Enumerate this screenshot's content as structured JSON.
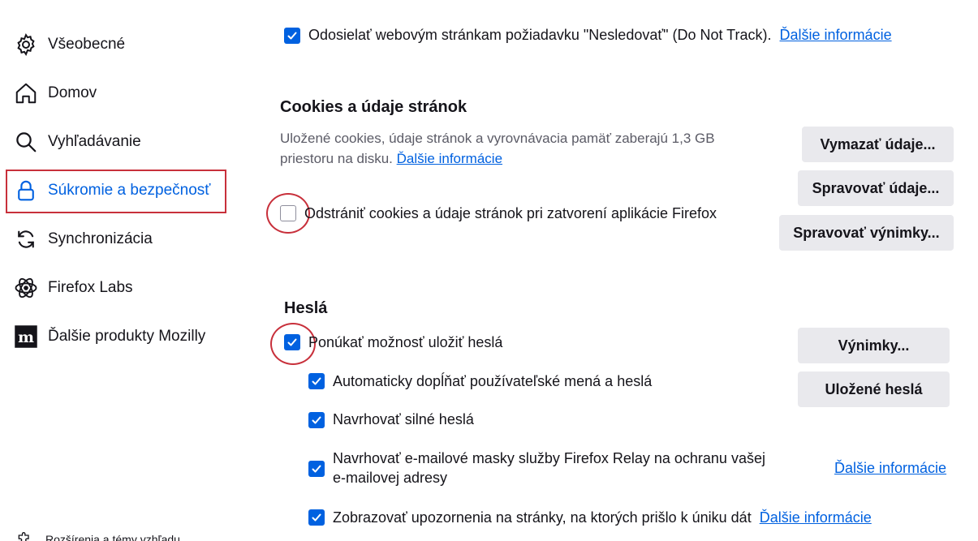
{
  "sidebar": {
    "items": [
      {
        "label": "Všeobecné",
        "icon": "gear-icon"
      },
      {
        "label": "Domov",
        "icon": "home-icon"
      },
      {
        "label": "Vyhľadávanie",
        "icon": "search-icon"
      },
      {
        "label": "Súkromie a bezpečnosť",
        "icon": "lock-icon",
        "active": true
      },
      {
        "label": "Synchronizácia",
        "icon": "sync-icon"
      },
      {
        "label": "Firefox Labs",
        "icon": "labs-icon"
      },
      {
        "label": "Ďalšie produkty Mozilly",
        "icon": "mozilla-icon"
      }
    ],
    "footer_label": "Rozšírenia a témy vzhľadu"
  },
  "dnt": {
    "label": "Odosielať webovým stránkam požiadavku \"Nesledovať\" (Do Not Track).",
    "link": "Ďalšie informácie",
    "checked": true
  },
  "cookies": {
    "heading": "Cookies a údaje stránok",
    "desc_line1": "Uložené cookies, údaje stránok a vyrovnávacia pamäť zaberajú 1,3 GB",
    "desc_line2": "priestoru na disku.",
    "desc_link": "Ďalšie informácie",
    "clear_btn": "Vymazať údaje...",
    "manage_btn": "Spravovať údaje...",
    "exceptions_btn": "Spravovať výnimky...",
    "delete_on_close": "Odstrániť cookies a údaje stránok pri zatvorení aplikácie Firefox",
    "delete_on_close_checked": false
  },
  "passwords": {
    "heading": "Heslá",
    "offer_save": "Ponúkať možnosť uložiť heslá",
    "autofill": "Automaticky dopĺňať používateľské mená a heslá",
    "suggest_strong": "Navrhovať silné heslá",
    "relay_line1": "Navrhovať e-mailové masky služby Firefox Relay na ochranu vašej",
    "relay_line2": "e-mailovej adresy",
    "relay_link": "Ďalšie informácie",
    "breach_alerts": "Zobrazovať upozornenia na stránky, na ktorých prišlo k úniku dát",
    "breach_link": "Ďalšie informácie",
    "exceptions_btn": "Výnimky...",
    "saved_btn": "Uložené heslá"
  },
  "colors": {
    "accent": "#0061e0",
    "annotation": "#c8303b",
    "button_bg": "#e9e9ed"
  }
}
